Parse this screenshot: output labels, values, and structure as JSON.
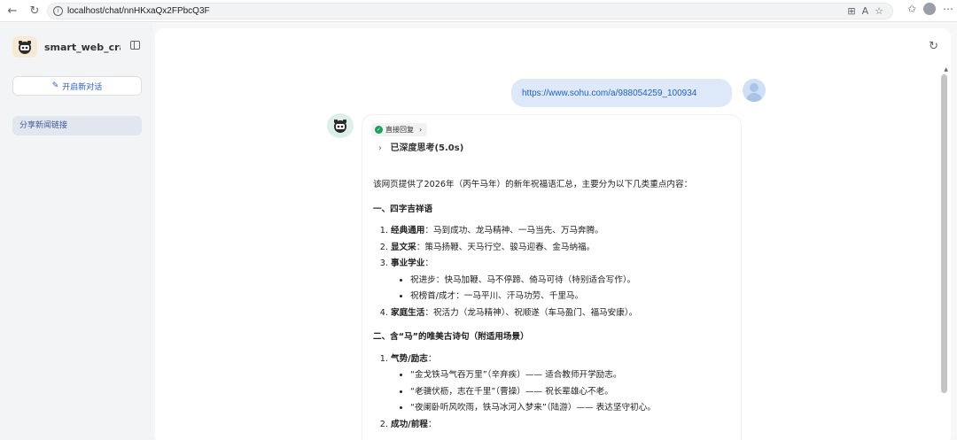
{
  "browser": {
    "url": "localhost/chat/nnHKxaQx2FPbcQ3F",
    "icons": [
      "back-icon",
      "refresh-icon",
      "info-icon",
      "split-icon",
      "read-aloud-icon",
      "favorite-icon",
      "collections-icon",
      "profile-icon",
      "more-icon"
    ]
  },
  "sidebar": {
    "app_name": "smart_web_cra...",
    "new_chat_label": "开启新对话",
    "history": [
      {
        "label": "分享新闻链接"
      }
    ]
  },
  "chat": {
    "user_message": "https://www.sohu.com/a/988054259_100934",
    "bot": {
      "direct_label": "直接回复",
      "thinking_label": "已深度思考(5.0s)",
      "intro": "该网页提供了2026年（丙午马年）的新年祝福语汇总，主要分为以下几类重点内容：",
      "sections": [
        {
          "heading": "一、四字吉祥语",
          "items": [
            {
              "title": "经典通用",
              "text": "：马到成功、龙马精神、一马当先、万马奔腾。"
            },
            {
              "title": "显文采",
              "text": "：策马扬鞭、天马行空、骏马迎春、金马纳福。"
            },
            {
              "title": "事业学业",
              "text": "：",
              "sub": [
                "祝进步：快马加鞭、马不停蹄、倚马可待（特别适合写作）。",
                "祝榜首/成才：一马平川、汗马功劳、千里马。"
              ]
            },
            {
              "title": "家庭生活",
              "text": "：祝活力（龙马精神）、祝顺遂（车马盈门、福马安康）。"
            }
          ]
        },
        {
          "heading": "二、含“马”的唯美古诗句（附适用场景）",
          "items": [
            {
              "title": "气势/励志",
              "text": "：",
              "sub": [
                "“金戈铁马气吞万里”（辛弃疾）—— 适合教师开学励志。",
                "“老骥伏枥，志在千里”（曹操）—— 祝长辈雄心不老。",
                "“夜阑卧听风吹雨，铁马冰河入梦来”（陆游）—— 表达坚守初心。"
              ]
            },
            {
              "title": "成功/前程",
              "text": "："
            }
          ]
        }
      ]
    }
  }
}
